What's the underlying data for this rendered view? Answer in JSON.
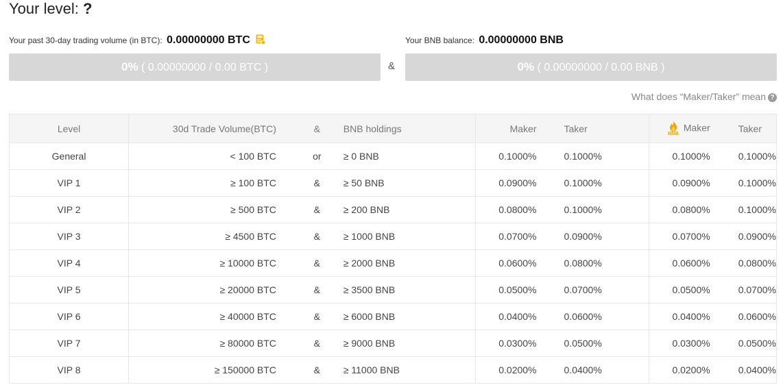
{
  "header": {
    "title_prefix": "Your level:",
    "title_value": "?"
  },
  "volume": {
    "label": "Your past 30-day trading volume (in BTC):",
    "value": "0.00000000 BTC",
    "progress_pct": "0%",
    "progress_detail": "( 0.00000000 / 0.00 BTC )",
    "progress_fraction": 0
  },
  "connector": "&",
  "bnb": {
    "label": "Your BNB balance:",
    "value": "0.00000000 BNB",
    "progress_pct": "0%",
    "progress_detail": "( 0.00000000 / 0.00 BNB )",
    "progress_fraction": 0
  },
  "help_link": "What does “Maker/Taker” mean",
  "table": {
    "headers": {
      "level": "Level",
      "volume": "30d Trade Volume(BTC)",
      "amp": "&",
      "bnb": "BNB holdings",
      "maker": "Maker",
      "taker": "Taker",
      "bnb_maker": "Maker",
      "bnb_taker": "Taker",
      "bnb_badge": "BNB"
    },
    "rows": [
      {
        "level": "General",
        "volume": "< 100 BTC",
        "op": "or",
        "bnb": "≥ 0 BNB",
        "maker": "0.1000%",
        "taker": "0.1000%",
        "bnb_maker": "0.1000%",
        "bnb_taker": "0.1000%"
      },
      {
        "level": "VIP 1",
        "volume": "≥ 100 BTC",
        "op": "&",
        "bnb": "≥ 50 BNB",
        "maker": "0.0900%",
        "taker": "0.1000%",
        "bnb_maker": "0.0900%",
        "bnb_taker": "0.1000%"
      },
      {
        "level": "VIP 2",
        "volume": "≥ 500 BTC",
        "op": "&",
        "bnb": "≥ 200 BNB",
        "maker": "0.0800%",
        "taker": "0.1000%",
        "bnb_maker": "0.0800%",
        "bnb_taker": "0.1000%"
      },
      {
        "level": "VIP 3",
        "volume": "≥ 4500 BTC",
        "op": "&",
        "bnb": "≥ 1000 BNB",
        "maker": "0.0700%",
        "taker": "0.0900%",
        "bnb_maker": "0.0700%",
        "bnb_taker": "0.0900%"
      },
      {
        "level": "VIP 4",
        "volume": "≥ 10000 BTC",
        "op": "&",
        "bnb": "≥ 2000 BNB",
        "maker": "0.0600%",
        "taker": "0.0800%",
        "bnb_maker": "0.0600%",
        "bnb_taker": "0.0800%"
      },
      {
        "level": "VIP 5",
        "volume": "≥ 20000 BTC",
        "op": "&",
        "bnb": "≥ 3500 BNB",
        "maker": "0.0500%",
        "taker": "0.0700%",
        "bnb_maker": "0.0500%",
        "bnb_taker": "0.0700%"
      },
      {
        "level": "VIP 6",
        "volume": "≥ 40000 BTC",
        "op": "&",
        "bnb": "≥ 6000 BNB",
        "maker": "0.0400%",
        "taker": "0.0600%",
        "bnb_maker": "0.0400%",
        "bnb_taker": "0.0600%"
      },
      {
        "level": "VIP 7",
        "volume": "≥ 80000 BTC",
        "op": "&",
        "bnb": "≥ 9000 BNB",
        "maker": "0.0300%",
        "taker": "0.0500%",
        "bnb_maker": "0.0300%",
        "bnb_taker": "0.0500%"
      },
      {
        "level": "VIP 8",
        "volume": "≥ 150000 BTC",
        "op": "&",
        "bnb": "≥ 11000 BNB",
        "maker": "0.0200%",
        "taker": "0.0400%",
        "bnb_maker": "0.0200%",
        "bnb_taker": "0.0400%"
      }
    ]
  },
  "colors": {
    "accent": "#f0b90b",
    "bar_bg": "#d7d7d7",
    "header_bg": "#f5f5f5"
  }
}
